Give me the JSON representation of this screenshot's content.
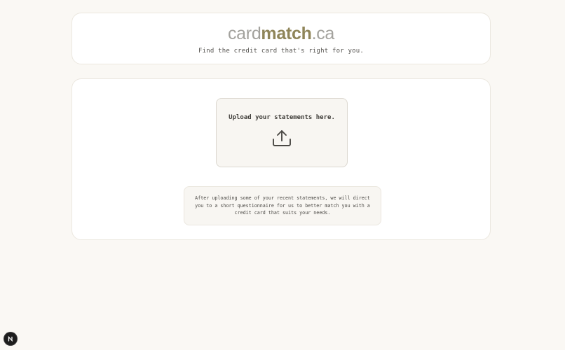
{
  "header": {
    "logo_light_prefix": "card",
    "logo_bold": "match",
    "logo_light_suffix": ".ca",
    "tagline": "Find the credit card that's right for you."
  },
  "upload": {
    "label": "Upload your statements here.",
    "icon": "upload-icon"
  },
  "info": {
    "text": "After uploading some of your recent statements, we will direct you to a short questionnaire for us to better match you with a credit card that suits your needs."
  },
  "dev_badge": {
    "label": "N",
    "icon": "nextjs-logo-icon"
  },
  "colors": {
    "background": "#faf8f4",
    "logo_light": "#a3a29d",
    "logo_accent": "#8f8559",
    "card_border": "#ebe7df"
  }
}
